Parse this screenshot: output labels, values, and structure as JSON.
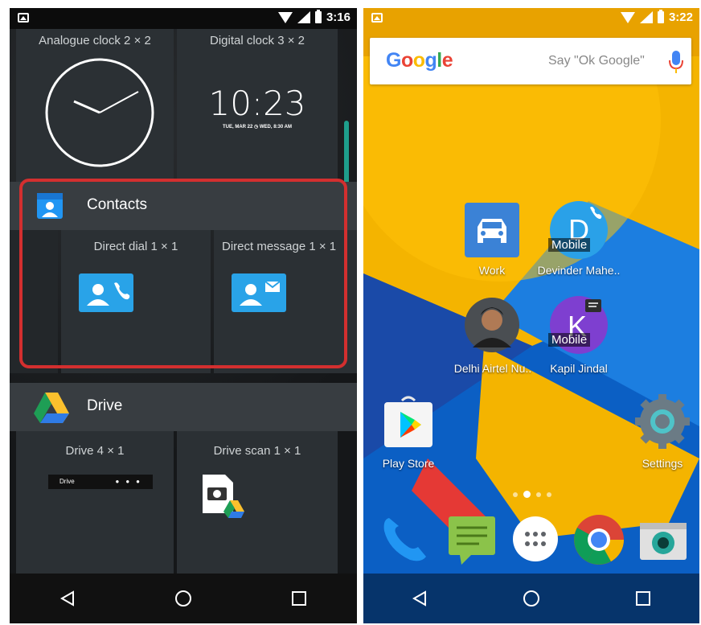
{
  "left_screen": {
    "status_time": "3:16",
    "widgets_top": {
      "analogue_clock_label": "Analogue clock  2 × 2",
      "digital_clock_label": "Digital clock  3 × 2",
      "digital_time": "10:23",
      "digital_date": "TUE, MAR 22 ◷ WED, 8:30 AM"
    },
    "contacts": {
      "title": "Contacts",
      "direct_dial_label": "Direct dial  1 × 1",
      "direct_message_label": "Direct message  1 × 1"
    },
    "drive": {
      "title": "Drive",
      "drive_widget_label": "Drive  4 × 1",
      "drive_scan_label": "Drive scan  1 × 1",
      "drive_bar_text": "Drive"
    },
    "highlight_color": "#d32f2f"
  },
  "right_screen": {
    "status_time": "3:22",
    "search": {
      "logo_text": "Google",
      "hint": "Say \"Ok Google\""
    },
    "apps": {
      "work_label": "Work",
      "devinder_label": "Devinder Mahe..",
      "devinder_tag": "Mobile",
      "devinder_initial": "D",
      "delhi_label": "Delhi Airtel Nu..",
      "kapil_label": "Kapil Jindal",
      "kapil_tag": "Mobile",
      "kapil_initial": "K",
      "play_store_label": "Play Store",
      "settings_label": "Settings"
    },
    "dock": [
      "phone-icon",
      "messages-icon",
      "app-drawer-icon",
      "chrome-icon",
      "camera-icon"
    ]
  }
}
